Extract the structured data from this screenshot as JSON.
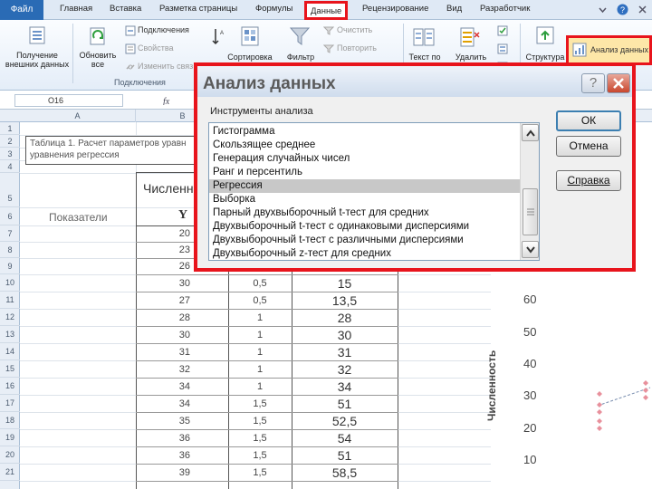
{
  "ribbon_tabs": {
    "file": "Файл",
    "home": "Главная",
    "insert": "Вставка",
    "page_layout": "Разметка страницы",
    "formulas": "Формулы",
    "data": "Данные",
    "review": "Рецензирование",
    "view": "Вид",
    "developer": "Разработчик"
  },
  "ribbon": {
    "get_external_data": "Получение внешних данных",
    "refresh_all": "Обновить все",
    "connections": "Подключения",
    "properties": "Свойства",
    "edit_links": "Изменить связ",
    "group_connections": "Подключения",
    "sort": "Сортировка",
    "filter": "Фильтр",
    "clear": "Очистить",
    "reapply": "Повторить",
    "text_to_columns": "Текст по",
    "remove_duplicates": "Удалить",
    "outline": "Структура",
    "data_analysis": "Анализ данных"
  },
  "formula_bar": {
    "name_box": "O16"
  },
  "columns": [
    "A",
    "B"
  ],
  "rows": [
    "1",
    "2",
    "3",
    "4",
    "5",
    "6",
    "7",
    "8",
    "9",
    "10",
    "11",
    "12",
    "13",
    "14",
    "15",
    "16",
    "17",
    "18",
    "19",
    "20",
    "21"
  ],
  "sheet": {
    "caption_line1": "Таблица 1. Расчет параметров уравн",
    "caption_line2": "уравнения регрессия",
    "header_indicators": "Показатели",
    "header_count": "Численн",
    "header_y": "Y",
    "y_values": [
      "20",
      "23",
      "26",
      "30",
      "27",
      "28",
      "30",
      "31",
      "32",
      "34",
      "34",
      "35",
      "36",
      "36",
      "39"
    ],
    "x_values": [
      "0,5",
      "0,5",
      "1",
      "1",
      "1",
      "1",
      "1",
      "1,5",
      "1,5",
      "1,5",
      "1,5",
      "1,5"
    ],
    "p_values": [
      "15",
      "13,5",
      "28",
      "30",
      "31",
      "32",
      "34",
      "51",
      "52,5",
      "54",
      "51",
      "58,5"
    ]
  },
  "chart": {
    "ylabel": "Численность",
    "yticks": [
      "60",
      "50",
      "40",
      "30",
      "20",
      "10"
    ],
    "point_color": "#e8909c",
    "trend_color": "#7a8fb0"
  },
  "dialog": {
    "title": "Анализ данных",
    "help_glyph": "?",
    "list_label": "Инструменты анализа",
    "items": [
      "Гистограмма",
      "Скользящее среднее",
      "Генерация случайных чисел",
      "Ранг и персентиль",
      "Регрессия",
      "Выборка",
      "Парный двухвыборочный t-тест для средних",
      "Двухвыборочный t-тест с одинаковыми дисперсиями",
      "Двухвыборочный t-тест с различными дисперсиями",
      "Двухвыборочный z-тест для средних"
    ],
    "selected": "Регрессия",
    "ok": "ОК",
    "cancel": "Отмена",
    "help": "Справка"
  },
  "colors": {
    "highlight": "#e8141c",
    "file_tab": "#2a6bb5"
  }
}
